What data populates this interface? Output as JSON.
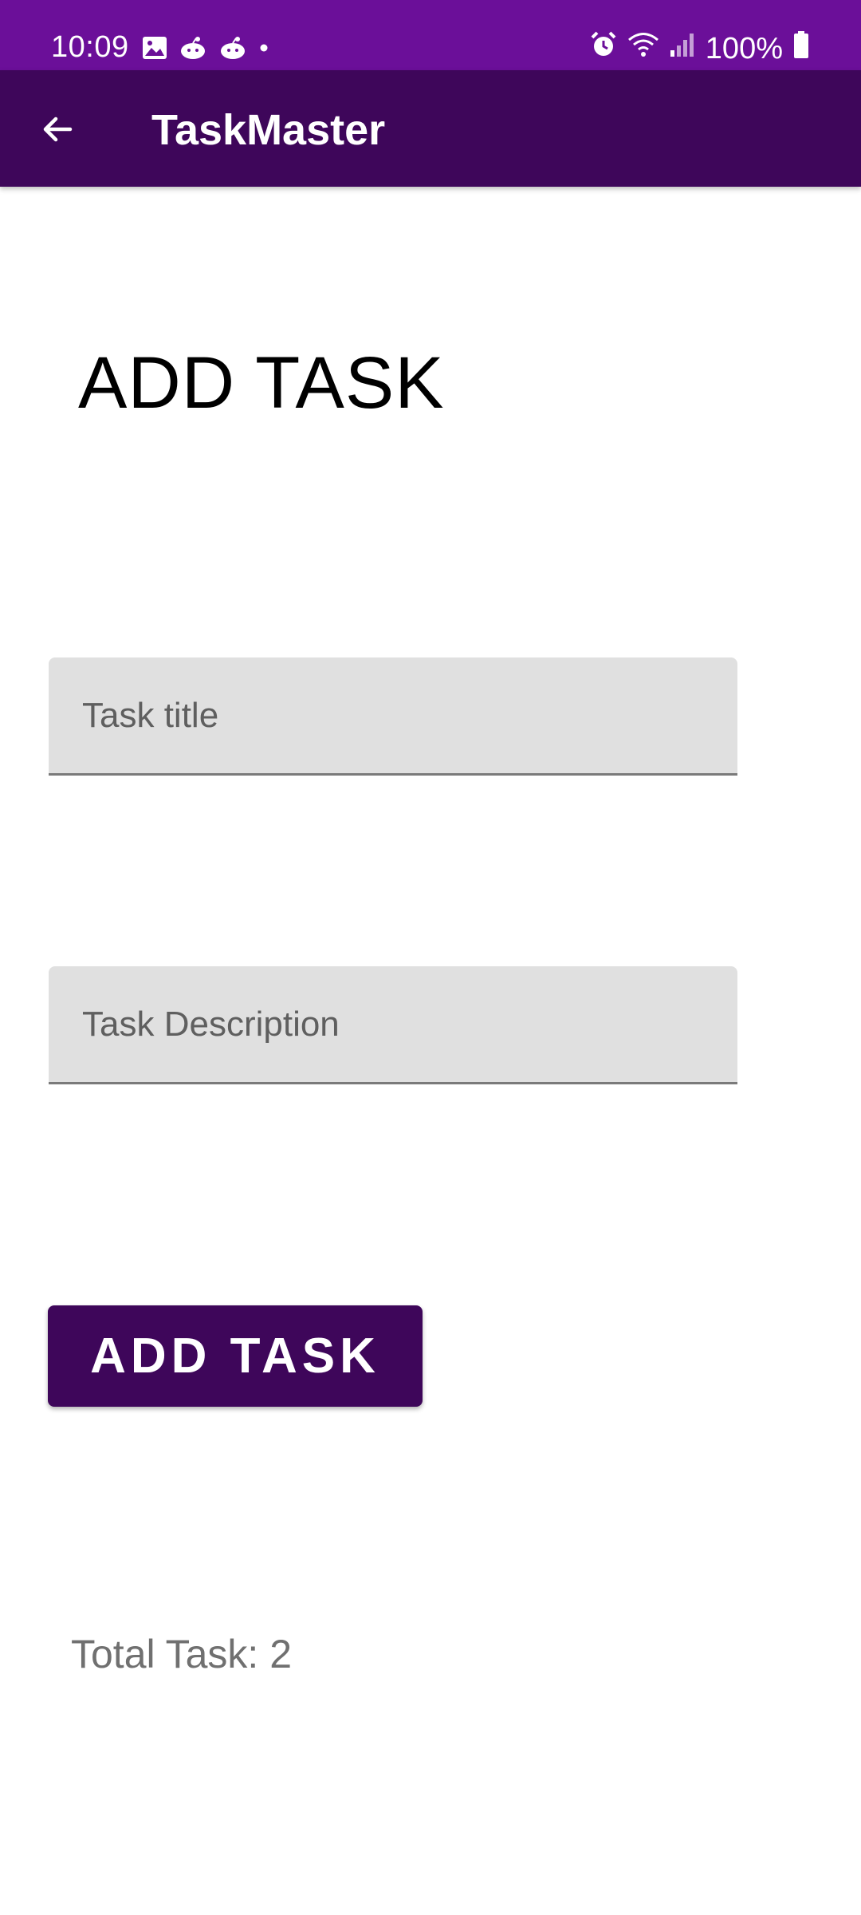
{
  "status_bar": {
    "time": "10:09",
    "battery": "100%",
    "icons_left": [
      "gallery-icon",
      "reddit-icon",
      "reddit-icon",
      "dot-icon"
    ],
    "icons_right": [
      "alarm-icon",
      "wifi-icon",
      "signal-icon",
      "battery-icon"
    ]
  },
  "app_bar": {
    "title": "TaskMaster",
    "back_icon": "arrow-back-icon"
  },
  "main": {
    "heading": "ADD TASK",
    "task_title_placeholder": "Task title",
    "task_title_value": "",
    "task_description_placeholder": "Task Description",
    "task_description_value": "",
    "add_button_label": "ADD TASK",
    "total_task_text": "Total Task: 2"
  },
  "colors": {
    "status_bar": "#6b0f99",
    "app_bar": "#3e065a",
    "button": "#3e065a",
    "field_background": "#e0e0e0"
  }
}
